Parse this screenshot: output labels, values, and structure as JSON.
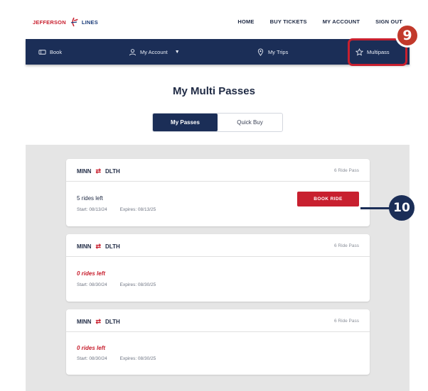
{
  "brand": {
    "name_left": "JEFFERSON",
    "name_right": "LINES"
  },
  "top_nav": [
    "HOME",
    "BUY TICKETS",
    "MY ACCOUNT",
    "SIGN OUT"
  ],
  "main_nav": {
    "book": "Book",
    "account": "My Account",
    "trips": "My Trips",
    "multipass": "Multipass"
  },
  "callouts": {
    "step_a": "9",
    "step_b": "10"
  },
  "page_title": "My Multi Passes",
  "toggle": {
    "active": "My Passes",
    "inactive": "Quick Buy"
  },
  "passes": [
    {
      "origin": "MINN",
      "destination": "DLTH",
      "type": "6 Ride Pass",
      "rides_left": "5 rides left",
      "start": "Start: 08/13/24",
      "expires": "Expires: 08/13/25",
      "action": "BOOK RIDE"
    },
    {
      "origin": "MINN",
      "destination": "DLTH",
      "type": "6 Ride Pass",
      "rides_left": "0 rides left",
      "start": "Start: 08/30/24",
      "expires": "Expires: 08/30/25"
    },
    {
      "origin": "MINN",
      "destination": "DLTH",
      "type": "6 Ride Pass",
      "rides_left": "0 rides left",
      "start": "Start: 08/30/24",
      "expires": "Expires: 08/30/25"
    }
  ],
  "colors": {
    "navy": "#1b2e57",
    "red": "#c8202f",
    "panel_gray": "#e5e5e5"
  },
  "icons": {
    "swap": "swap-arrows-icon",
    "book": "ticket-icon",
    "account": "user-icon",
    "trips": "location-pin-icon",
    "multipass": "star-icon"
  }
}
